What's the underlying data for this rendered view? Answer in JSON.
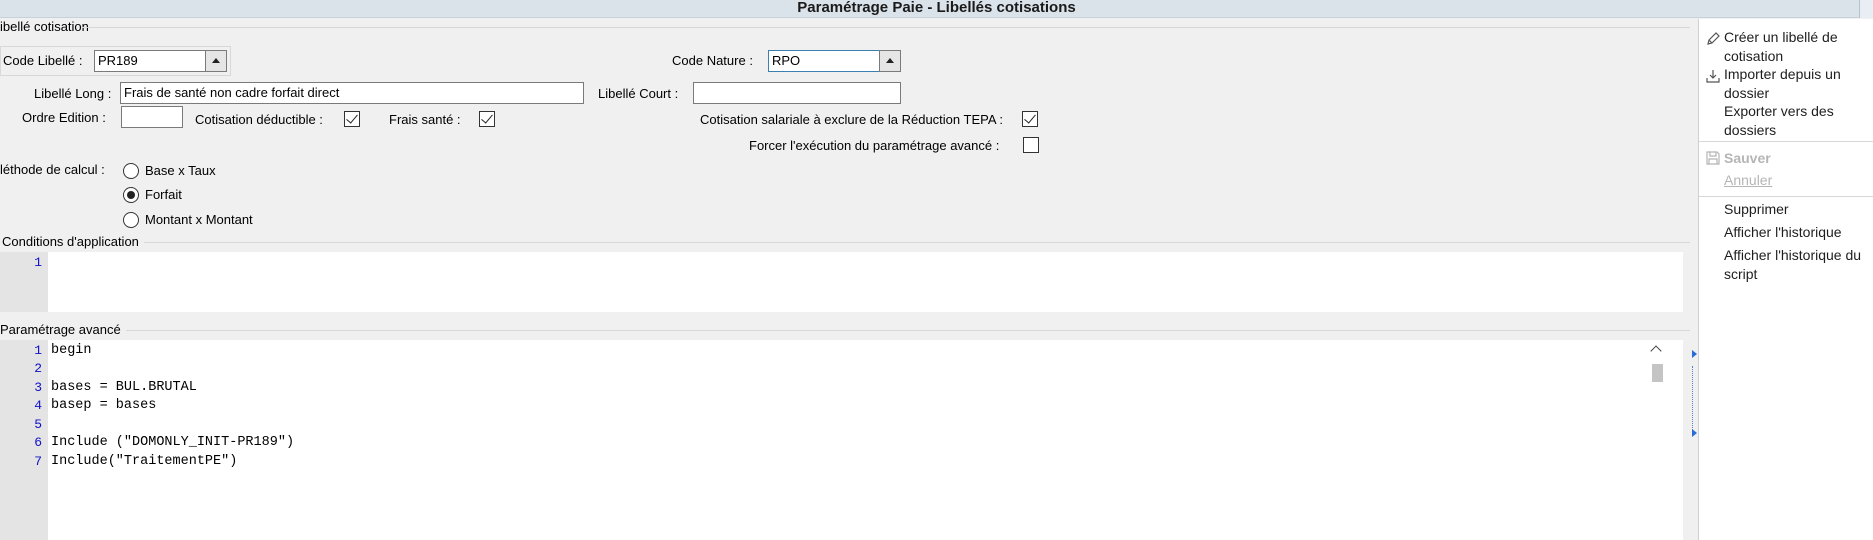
{
  "window": {
    "title": "Paramétrage Paie - Libellés cotisations"
  },
  "group_cotisation": {
    "label": "ibellé cotisation",
    "code_libelle": {
      "label": "Code Libellé :",
      "value": "PR189"
    },
    "code_nature": {
      "label": "Code Nature :",
      "value": "RPO"
    },
    "libelle_long": {
      "label": "Libellé Long :",
      "value": "Frais de santé non cadre forfait direct"
    },
    "libelle_court": {
      "label": "Libellé Court :",
      "value": ""
    },
    "ordre_edition": {
      "label": "Ordre Edition :",
      "value": ""
    },
    "cotisation_deductible": {
      "label": "Cotisation déductible :",
      "checked": true
    },
    "frais_sante": {
      "label": "Frais santé :",
      "checked": true
    },
    "exclure_tepa": {
      "label": "Cotisation salariale à exclure de la Réduction TEPA :",
      "checked": true
    },
    "forcer_execution": {
      "label": "Forcer l'exécution du paramétrage avancé :",
      "checked": false
    },
    "methode_calcul": {
      "label": "léthode de calcul :",
      "options": [
        "Base x Taux",
        "Forfait",
        "Montant x Montant"
      ],
      "selected": "Forfait"
    }
  },
  "conditions": {
    "label": "Conditions d'application",
    "line_numbers": [
      "1"
    ],
    "lines": [
      ""
    ]
  },
  "parametrage_avance": {
    "label": "Paramétrage avancé",
    "line_numbers": [
      "1",
      "2",
      "3",
      "4",
      "5",
      "6",
      "7"
    ],
    "lines": [
      "begin",
      "",
      "bases = BUL.BRUTAL",
      "basep = bases",
      "",
      "Include (\"DOMONLY_INIT-PR189\")",
      "Include(\"TraitementPE\")"
    ]
  },
  "actions": {
    "create": "Créer un libellé de cotisation",
    "import": "Importer depuis un dossier",
    "export": "Exporter vers des dossiers",
    "save": "Sauver",
    "cancel": "Annuler",
    "delete": "Supprimer",
    "history": "Afficher l'historique",
    "script_history": "Afficher l'historique du script"
  },
  "colors": {
    "line_number": "#1010c8",
    "marker": "#2a6bd6",
    "disabled": "#b5b5b5"
  }
}
